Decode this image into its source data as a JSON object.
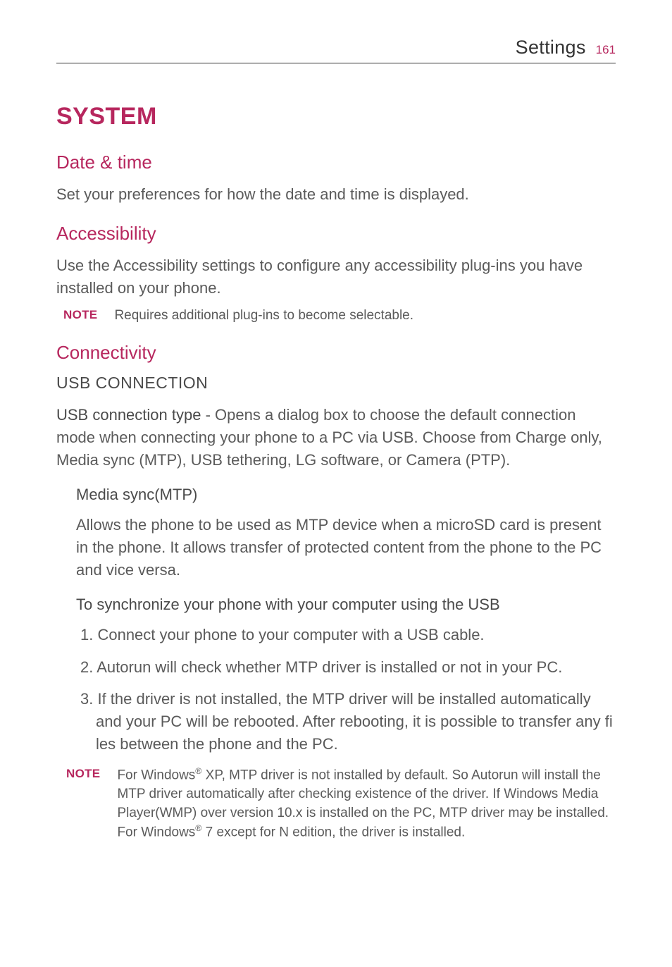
{
  "header": {
    "title": "Settings",
    "page_number": "161"
  },
  "h1": "SYSTEM",
  "sections": {
    "date_time": {
      "heading": "Date & time",
      "body": "Set your preferences for how the date and time is displayed."
    },
    "accessibility": {
      "heading": "Accessibility",
      "body": "Use the Accessibility settings to configure any accessibility plug-ins you have installed on your phone.",
      "note_label": "NOTE",
      "note_text": "Requires additional plug-ins to become selectable."
    },
    "connectivity": {
      "heading": "Connectivity",
      "subheading": "USB CONNECTION",
      "usb_type_lead": "USB connection type",
      "usb_type_body": " - Opens a dialog box to choose the default connection mode when connecting your phone to a PC via USB. Choose from Charge only, Media sync (MTP), USB tethering, LG software, or Camera (PTP).",
      "mtp": {
        "heading": "Media sync(MTP)",
        "body": "Allows the phone to be used as MTP device when a microSD card is present in the phone. It allows transfer of protected content from the phone to the PC and vice versa.",
        "sync_heading": "To synchronize your phone with your computer using the USB",
        "steps": [
          "1. Connect your phone to your computer with a USB cable.",
          "2. Autorun will check whether MTP driver is installed or not in your PC.",
          "3. If the driver is not installed, the MTP driver will be installed automatically and your PC will be rebooted. After rebooting, it is possible to transfer any fi les between the phone and the PC."
        ],
        "note_label": "NOTE",
        "note_prefix": "For Windows",
        "note_mid": " XP, MTP driver is not installed by default. So Autorun will install the MTP driver automatically after checking existence of the driver. If Windows Media Player(WMP) over version 10.x is installed on the PC, MTP driver may be installed. For Windows",
        "note_suffix": " 7 except for N edition, the driver is installed."
      }
    }
  }
}
